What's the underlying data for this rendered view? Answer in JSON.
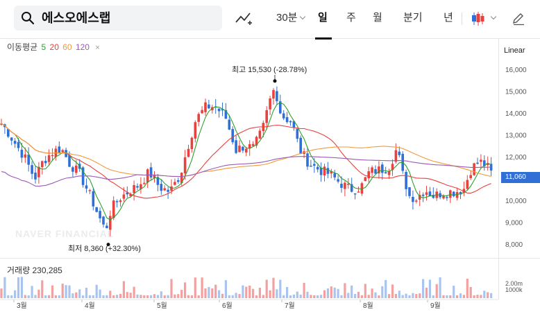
{
  "search": {
    "query": "에스오에스랩"
  },
  "periods": [
    {
      "label": "30분",
      "has_menu": true
    },
    {
      "label": "일",
      "active": true
    },
    {
      "label": "주"
    },
    {
      "label": "월"
    },
    {
      "label": "분기"
    },
    {
      "label": "년"
    }
  ],
  "ma_legend": {
    "title": "이동평균",
    "p5": "5",
    "p20": "20",
    "p60": "60",
    "p120": "120"
  },
  "colors": {
    "up": "#e8413e",
    "down": "#2f6fd6",
    "ma5": "#2ca02c",
    "ma20": "#e8413e",
    "ma60": "#f29a3a",
    "ma120": "#9b59b6",
    "current": "#2f6fd6"
  },
  "scale_mode": "Linear",
  "y_ticks": [
    "16,000",
    "15,000",
    "14,000",
    "13,000",
    "12,000",
    "11,000",
    "10,000",
    "9,000",
    "8,000"
  ],
  "current_price": "11,060",
  "annotations": {
    "high": {
      "label": "최고",
      "value": "15,530 (-28.78%)"
    },
    "low": {
      "label": "최저",
      "value": "8,360 (+32.30%)"
    }
  },
  "volume": {
    "title": "거래량",
    "value": "230,285",
    "ticks": [
      "2.00m",
      "1000k"
    ]
  },
  "x_ticks": [
    "3월",
    "4월",
    "5월",
    "6월",
    "7월",
    "8월",
    "9월"
  ],
  "watermark": "NAVER FINANCIAL",
  "chart_data": {
    "type": "candlestick",
    "ylim": [
      7600,
      16500
    ],
    "x": [
      "3월",
      "4월",
      "5월",
      "6월",
      "7월",
      "8월",
      "9월"
    ],
    "high_marker": 15530,
    "low_marker": 8360,
    "last_close": 11060
  }
}
